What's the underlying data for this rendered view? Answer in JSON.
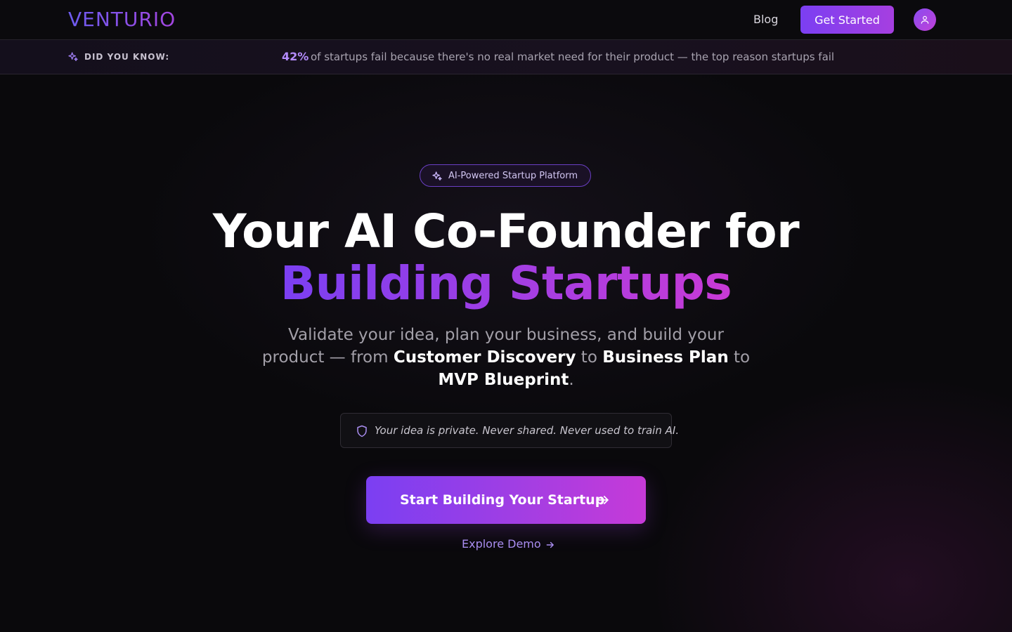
{
  "nav": {
    "logo": "VENTURIO",
    "blog_label": "Blog",
    "cta_label": "Get Started",
    "avatar_icon": "user-icon"
  },
  "banner": {
    "label": "DID YOU KNOW:",
    "stat": "42%",
    "text": "of startups fail because there's no real market need for their product — the top reason startups fail",
    "icon": "sparkles-icon"
  },
  "hero": {
    "badge": "AI-Powered Startup Platform",
    "title_line1": "Your AI Co-Founder for",
    "title_line2": "Building Startups",
    "subtitle": {
      "part1": "Validate your idea, plan your business, and build your product — from ",
      "bold1": "Customer Discovery",
      "part2": " to ",
      "bold2": "Business Plan",
      "part3": " to ",
      "bold3": "MVP Blueprint",
      "part4": "."
    },
    "privacy_note": "Your idea is private. Never shared. Never used to train AI.",
    "privacy_icon": "shield-icon",
    "cta_label": "Start Building Your Startup",
    "demo_label": "Explore Demo"
  },
  "colors": {
    "accent_start": "#7b3ff2",
    "accent_end": "#c83ad6",
    "background": "#0a090c"
  }
}
